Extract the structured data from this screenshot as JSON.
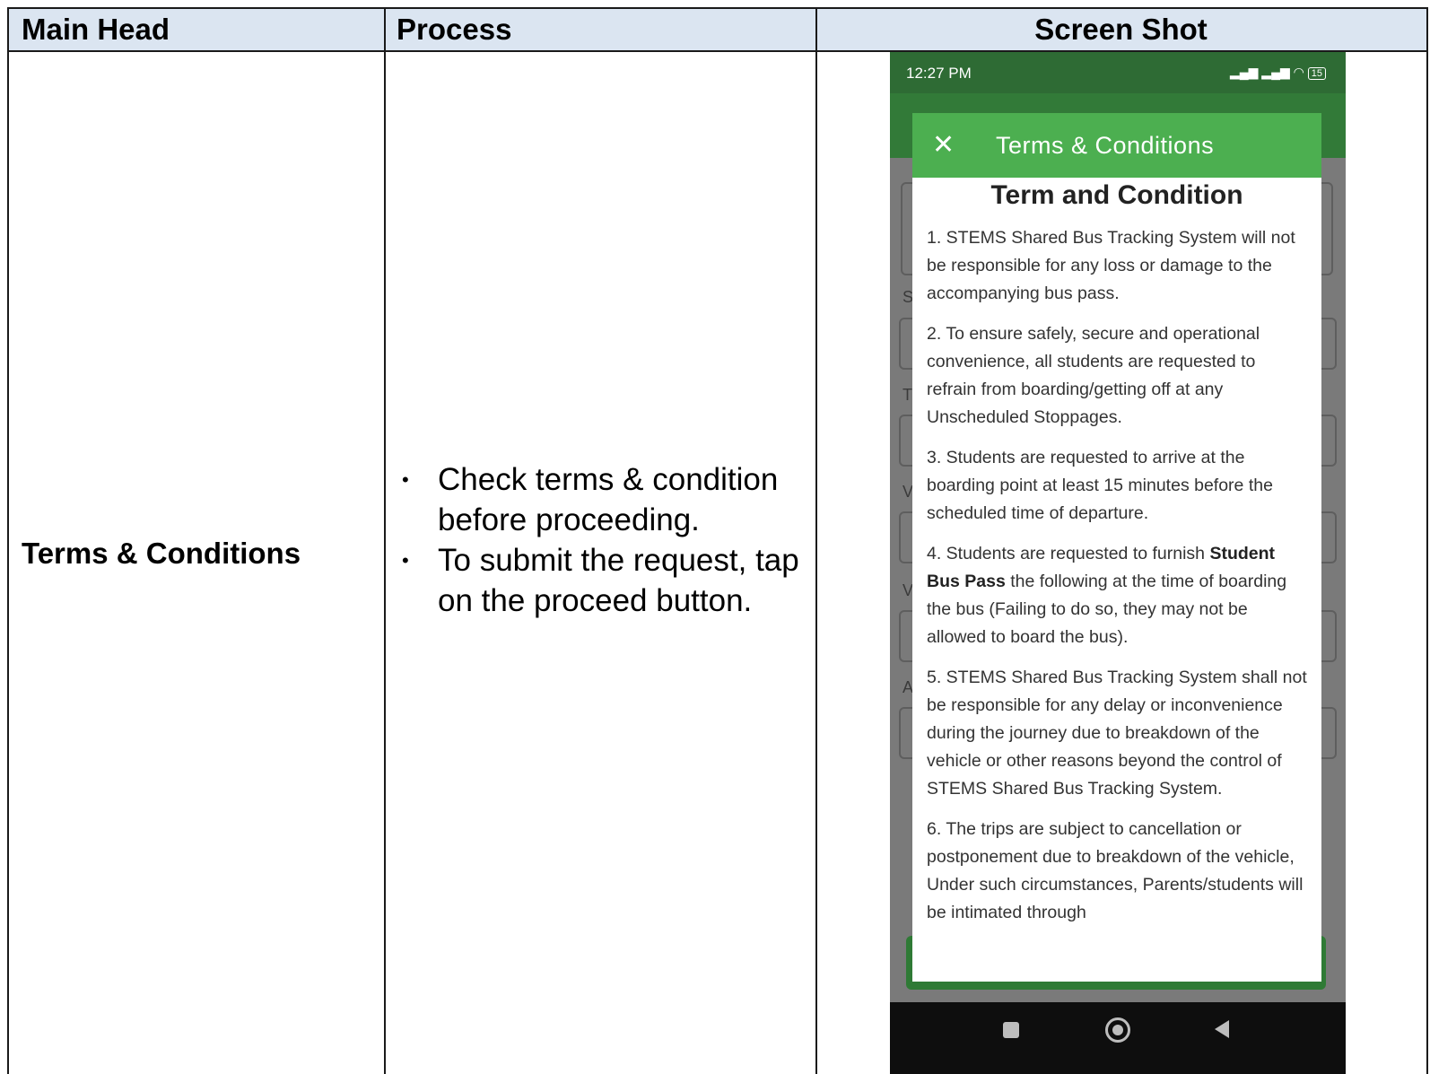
{
  "table": {
    "headers": {
      "main_head": "Main Head",
      "process": "Process",
      "screen_shot": "Screen Shot"
    },
    "row": {
      "main_head": "Terms & Conditions",
      "process_steps": [
        "Check terms & condition before proceeding.",
        "To submit the request, tap on the proceed button."
      ]
    }
  },
  "phone": {
    "status_time": "12:27 PM",
    "battery": "15",
    "dialog": {
      "title": "Terms & Conditions",
      "heading": "Term and Condition",
      "terms": [
        {
          "pre": "1. STEMS Shared Bus Tracking System will not be responsible for any loss or damage to the accompanying bus pass.",
          "bold": "",
          "post": ""
        },
        {
          "pre": "2. To ensure safely, secure and operational convenience, all students are requested to refrain from boarding/getting off at any Unscheduled Stoppages.",
          "bold": "",
          "post": ""
        },
        {
          "pre": "3. Students are requested to arrive at the boarding point at least 15 minutes before the scheduled time of departure.",
          "bold": "",
          "post": ""
        },
        {
          "pre": "4. Students are requested to furnish ",
          "bold": "Student Bus Pass",
          "post": " the following at the time of boarding the bus (Failing to do so, they may not be allowed to board the bus)."
        },
        {
          "pre": "5. STEMS Shared Bus Tracking System shall not be responsible for any delay or inconvenience during the journey due to breakdown of the vehicle or other reasons beyond the control of STEMS Shared Bus Tracking System.",
          "bold": "",
          "post": ""
        },
        {
          "pre": "6. The trips are subject to cancellation or postponement due to breakdown of the vehicle, Under such circumstances, Parents/students will be intimated through",
          "bold": "",
          "post": ""
        }
      ]
    },
    "background_letters": [
      "S",
      "T",
      "V",
      "V",
      "A"
    ]
  }
}
